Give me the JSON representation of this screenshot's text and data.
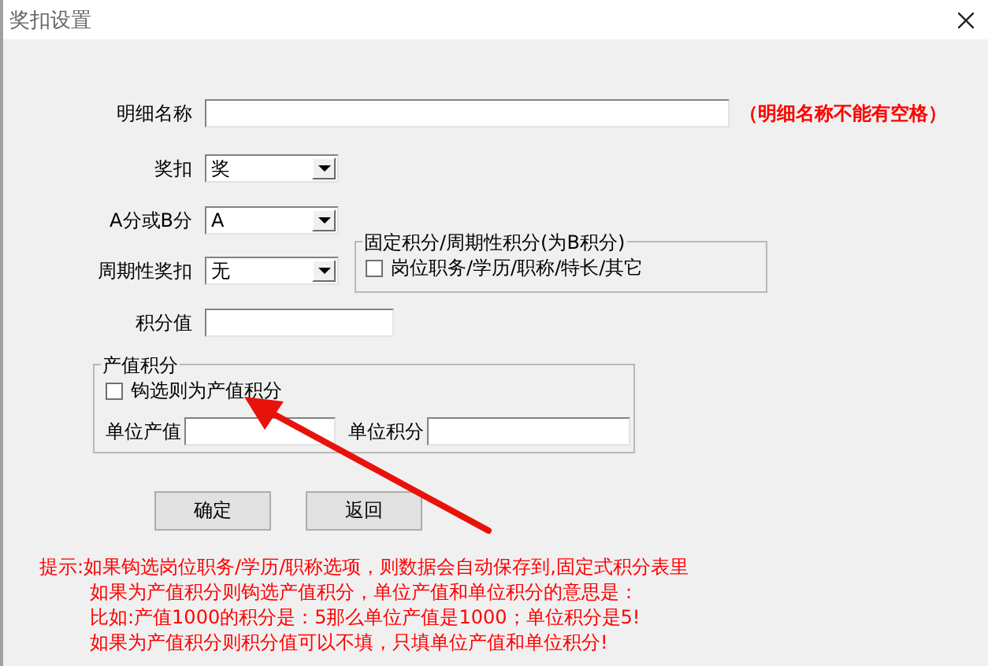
{
  "window": {
    "title": "奖扣设置"
  },
  "fields": [
    {
      "label": "明细名称",
      "kind": "text",
      "note": "（明细名称不能有空格）"
    },
    {
      "label": "奖扣",
      "kind": "select",
      "value": "奖"
    },
    {
      "label": "A分或B分",
      "kind": "select",
      "value": "A"
    },
    {
      "label": "周期性奖扣",
      "kind": "select",
      "value": "无"
    },
    {
      "label": "积分值",
      "kind": "text"
    }
  ],
  "fixed_group": {
    "title": "固定积分/周期性积分(为B积分)",
    "checkbox": {
      "label": "岗位职务/学历/职称/特长/其它",
      "checked": false
    }
  },
  "output_group": {
    "title": "产值积分",
    "checkbox": {
      "label": "钩选则为产值积分",
      "checked": false
    },
    "fields": [
      {
        "label": "单位产值"
      },
      {
        "label": "单位积分"
      }
    ]
  },
  "buttons": [
    "确定",
    "返回"
  ],
  "hint": [
    "提示:如果钩选岗位职务/学历/职称选项，则数据会自动保存到,固定式积分表里",
    "如果为产值积分则钩选产值积分，单位产值和单位积分的意思是：",
    "比如:产值1000的积分是：5那么单位产值是1000；单位积分是5!",
    "如果为产值积分则积分值可以不填，只填单位产值和单位积分!"
  ]
}
